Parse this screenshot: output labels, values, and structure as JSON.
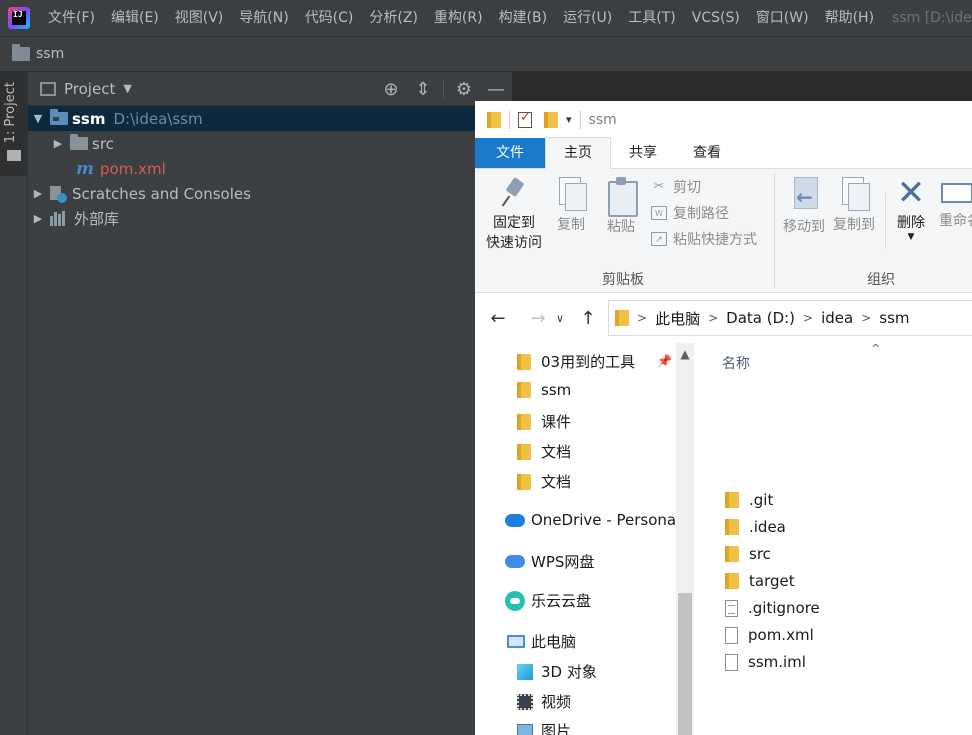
{
  "ide": {
    "logo_text": "IJ",
    "menu": [
      "文件(F)",
      "编辑(E)",
      "视图(V)",
      "导航(N)",
      "代码(C)",
      "分析(Z)",
      "重构(R)",
      "构建(B)",
      "运行(U)",
      "工具(T)",
      "VCS(S)",
      "窗口(W)",
      "帮助(H)"
    ],
    "window_title": "ssm [D:\\idea",
    "breadcrumb": "ssm",
    "stripe_label": "1: Project",
    "project_panel": {
      "title": "Project",
      "tree": [
        {
          "label": "ssm",
          "hint": "D:\\idea\\ssm",
          "expanded": true,
          "selected": true
        },
        {
          "label": "src",
          "expanded": false
        },
        {
          "label": "pom.xml"
        },
        {
          "label": "Scratches and Consoles",
          "expanded": false
        },
        {
          "label": "外部库",
          "expanded": false
        }
      ]
    }
  },
  "explorer": {
    "title": "ssm",
    "tabs": [
      "文件",
      "主页",
      "共享",
      "查看"
    ],
    "active_tab": "主页",
    "ribbon": {
      "pin_label_1": "固定到",
      "pin_label_2": "快速访问",
      "copy": "复制",
      "paste": "粘贴",
      "cut": "剪切",
      "copy_path": "复制路径",
      "paste_shortcut": "粘贴快捷方式",
      "clipboard_group": "剪贴板",
      "move_to": "移动到",
      "copy_to": "复制到",
      "delete": "删除",
      "rename": "重命名",
      "organize_group": "组织"
    },
    "address": [
      "此电脑",
      "Data (D:)",
      "idea",
      "ssm"
    ],
    "nav_pane": {
      "quick_access": [
        "03用到的工具",
        "ssm",
        "课件",
        "文档",
        "文档"
      ],
      "onedrive": "OneDrive - Personal",
      "wps": "WPS网盘",
      "leyun": "乐云云盘",
      "this_pc": "此电脑",
      "pc_items": [
        "3D 对象",
        "视频",
        "图片"
      ]
    },
    "file_list": {
      "column": "名称",
      "items": [
        {
          "name": ".git",
          "type": "folder"
        },
        {
          "name": ".idea",
          "type": "folder"
        },
        {
          "name": "src",
          "type": "folder"
        },
        {
          "name": "target",
          "type": "folder"
        },
        {
          "name": ".gitignore",
          "type": "text"
        },
        {
          "name": "pom.xml",
          "type": "file"
        },
        {
          "name": "ssm.iml",
          "type": "file"
        }
      ]
    }
  }
}
